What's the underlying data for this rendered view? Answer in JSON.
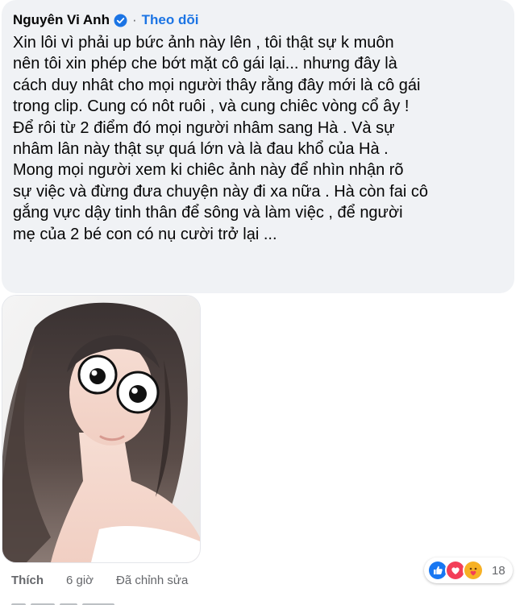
{
  "comment": {
    "author": "Nguyên Vi Anh",
    "follow_label": "Theo dõi",
    "lines": [
      "Xin lôi vì phải up bức ảnh này lên , tôi thật sự k muôn",
      "nên tôi xin phép che bớt mặt cô gái lại... nhưng đây là",
      "cách duy nhât cho mọi người thây rằng đây mới là cô gái",
      "trong clip. Cung có nôt ruôi , và cung chiêc vòng cổ ây !",
      "Để rôi từ 2 điểm đó mọi người nhâm sang Hà . Và sự",
      "nhâm lân này thật sự quá lớn và là đau khổ của Hà .",
      "Mong mọi người xem ki chiêc ảnh này để nhìn nhận rõ",
      "sự việc và đừng đưa chuyện này đi xa nữa . Hà còn fai cô",
      "gắng vực dậy tinh thân để sông và làm việc , để người",
      "mẹ của 2 bé con có nụ cười trở lại ..."
    ]
  },
  "actions": {
    "like_label": "Thích",
    "time": "6 giờ",
    "edited": "Đã chỉnh sửa"
  },
  "reactions": {
    "count": "18",
    "icons": [
      "like-reaction-icon",
      "love-reaction-icon",
      "care-reaction-icon"
    ]
  },
  "colors": {
    "bubble": "#f0f2f5",
    "link_blue": "#1b74e4",
    "secondary_text": "#65676b"
  }
}
